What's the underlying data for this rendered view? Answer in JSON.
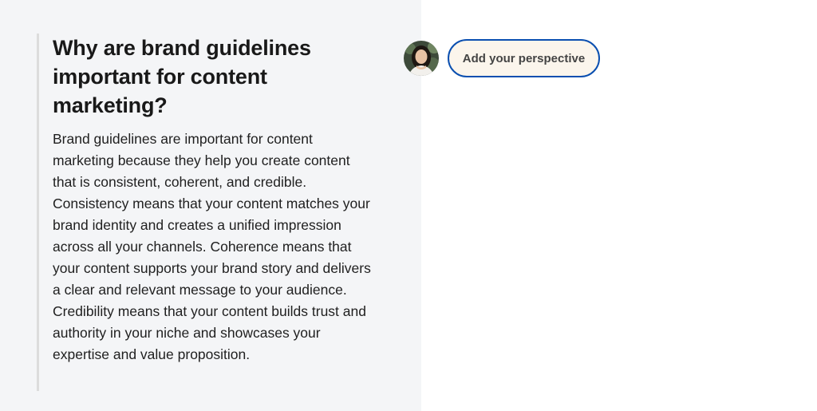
{
  "article": {
    "title": "Why are brand guidelines important for content marketing?",
    "body": "Brand guidelines are important for content marketing because they help you create content that is consistent, coherent, and credible. Consistency means that your content matches your brand identity and creates a unified impression across all your channels. Coherence means that your content supports your brand story and delivers a clear and relevant message to your audience. Credibility means that your content builds trust and authority in your niche and showcases your expertise and value proposition."
  },
  "contribution": {
    "avatar_icon": "user-avatar-photo",
    "button_label": "Add your perspective"
  },
  "colors": {
    "left_panel_bg": "#f4f5f7",
    "button_border": "#0a4fb0",
    "button_bg": "#fbf5ec"
  }
}
